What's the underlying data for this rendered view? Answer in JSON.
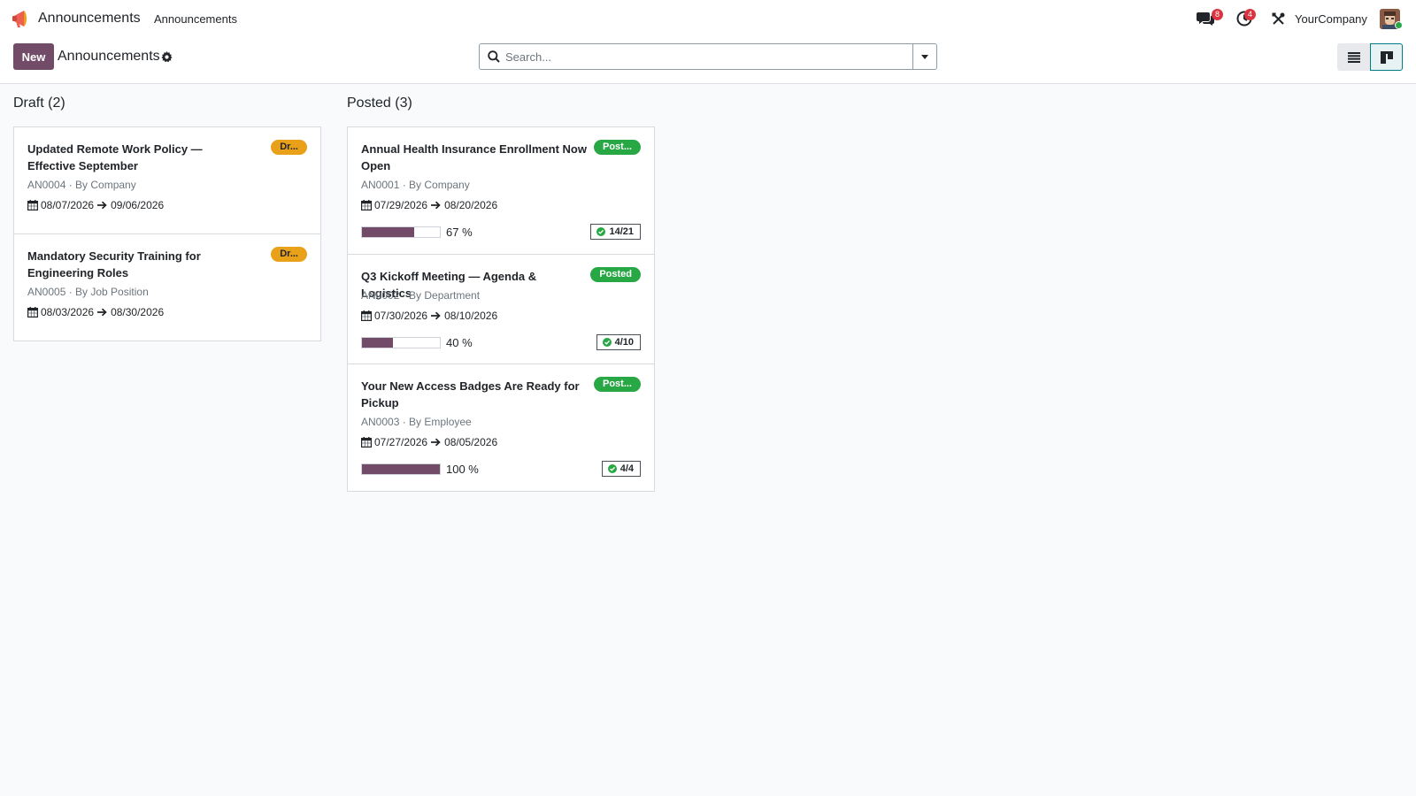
{
  "navbar": {
    "app_name": "Announcements",
    "menu_item": "Announcements",
    "messages_count": "8",
    "activities_count": "4",
    "company": "YourCompany"
  },
  "control_panel": {
    "new_label": "New",
    "title": "Announcements",
    "search_placeholder": "Search..."
  },
  "colors": {
    "brand": "#714b67",
    "draft": "#e9a11a",
    "posted": "#28a745",
    "notification": "#d9343f"
  },
  "columns": [
    {
      "header": "Draft (2)",
      "cards": [
        {
          "title": "Updated Remote Work Policy — Effective September",
          "state": "Dr...",
          "ref": "AN0004 · By Company",
          "date_from": "08/07/2026",
          "date_to": "09/06/2026"
        },
        {
          "title": "Mandatory Security Training for Engineering Roles",
          "state": "Dr...",
          "ref": "AN0005 · By Job Position",
          "date_from": "08/03/2026",
          "date_to": "08/30/2026"
        }
      ]
    },
    {
      "header": "Posted (3)",
      "cards": [
        {
          "title": "Annual Health Insurance Enrollment Now Open",
          "state": "Post...",
          "ref": "AN0001 · By Company",
          "date_from": "07/29/2026",
          "date_to": "08/20/2026",
          "progress_percent": 67,
          "progress_label": "67 %",
          "ack": "14/21"
        },
        {
          "title": "Q3 Kickoff Meeting — Agenda & Logistics",
          "state": "Posted",
          "ref": "AN0002 · By Department",
          "date_from": "07/30/2026",
          "date_to": "08/10/2026",
          "progress_percent": 40,
          "progress_label": "40 %",
          "ack": "4/10"
        },
        {
          "title": "Your New Access Badges Are Ready for Pickup",
          "state": "Post...",
          "ref": "AN0003 · By Employee",
          "date_from": "07/27/2026",
          "date_to": "08/05/2026",
          "progress_percent": 100,
          "progress_label": "100 %",
          "ack": "4/4"
        }
      ]
    }
  ]
}
